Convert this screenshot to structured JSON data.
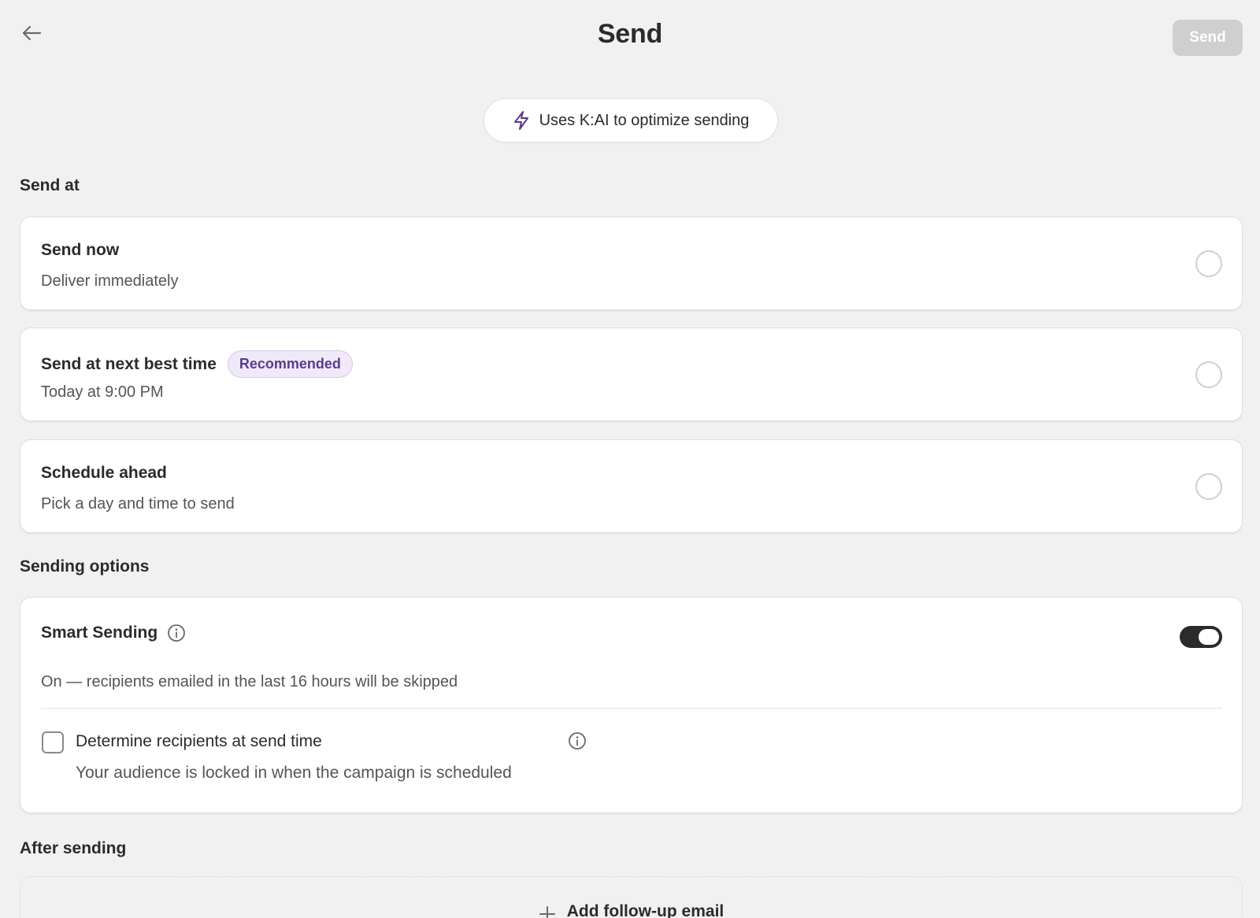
{
  "header": {
    "title": "Send",
    "send_label": "Send"
  },
  "kai": {
    "label": "Uses K:AI to optimize sending"
  },
  "send_at": {
    "heading": "Send at",
    "options": [
      {
        "title": "Send now",
        "subtitle": "Deliver immediately"
      },
      {
        "title": "Send at next best time",
        "badge": "Recommended",
        "subtitle": "Today at 9:00 PM"
      },
      {
        "title": "Schedule ahead",
        "subtitle": "Pick a day and time to send"
      }
    ]
  },
  "sending_options": {
    "heading": "Sending options",
    "smart_sending": {
      "title": "Smart Sending",
      "enabled": true,
      "description": "On — recipients emailed in the last 16 hours will be skipped"
    },
    "determine_recipients": {
      "label": "Determine recipients at send time",
      "checked": false,
      "description": "Your audience is locked in when the campaign is scheduled"
    }
  },
  "after_sending": {
    "heading": "After sending",
    "add_followup_label": "Add follow-up email"
  },
  "colors": {
    "background": "#f1f1f1",
    "accent_purple": "#5c3a8e",
    "badge_bg": "#efe9f8",
    "toggle_on": "#2b2b2b",
    "disabled_button": "#cfcfcf"
  },
  "icons": {
    "back": "arrow-left-icon",
    "kai": "lightning-icon",
    "info": "info-icon",
    "add": "plus-icon"
  }
}
